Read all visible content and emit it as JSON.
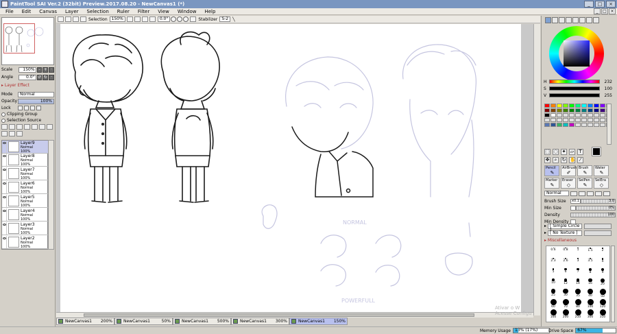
{
  "window": {
    "title": "PaintTool SAI Ver.2 (32bit) Preview.2017.08.20 - NewCanvas1 (*)",
    "controls": [
      "_",
      "□",
      "×"
    ]
  },
  "menu": [
    "File",
    "Edit",
    "Canvas",
    "Layer",
    "Selection",
    "Ruler",
    "Filter",
    "View",
    "Window",
    "Help"
  ],
  "navigator": {
    "scale_label": "Scale",
    "scale_value": "150%",
    "angle_label": "Angle",
    "angle_value": "0.0°"
  },
  "layer_panel": {
    "effect_header": "Layer Effect",
    "mode_label": "Mode",
    "mode_value": "Normal",
    "opacity_label": "Opacity",
    "opacity_value": "100%",
    "lock_label": "Lock",
    "clipping_label": "Clipping Group",
    "selection_label": "Selection Source",
    "layers": [
      {
        "name": "Layer9",
        "mode": "Normal",
        "opacity": "100%"
      },
      {
        "name": "Layer8",
        "mode": "Normal",
        "opacity": "100%"
      },
      {
        "name": "Layer7",
        "mode": "Normal",
        "opacity": "100%"
      },
      {
        "name": "Layer6",
        "mode": "Normal",
        "opacity": "100%"
      },
      {
        "name": "Layer5",
        "mode": "Normal",
        "opacity": "100%"
      },
      {
        "name": "Layer4",
        "mode": "Normal",
        "opacity": "100%"
      },
      {
        "name": "Layer3",
        "mode": "Normal",
        "opacity": "100%"
      },
      {
        "name": "Layer2",
        "mode": "Normal",
        "opacity": "100%"
      }
    ]
  },
  "canvas_toolbar": {
    "selection_label": "Selection",
    "zoom": "150%",
    "angle": "0.0°",
    "stabilizer_label": "Stabilizer",
    "stabilizer_value": "S-2"
  },
  "canvas_tabs": [
    {
      "name": "NewCanvas1",
      "zoom": "200%",
      "active": false
    },
    {
      "name": "NewCanvas1",
      "zoom": "50%",
      "active": false
    },
    {
      "name": "NewCanvas1",
      "zoom": "500%",
      "active": false
    },
    {
      "name": "NewCanvas1",
      "zoom": "300%",
      "active": false
    },
    {
      "name": "NewCanvas1",
      "zoom": "150%",
      "active": true
    }
  ],
  "watermark": {
    "line1": "Ativar o W",
    "line2": "Acesse Configu"
  },
  "sketch_labels": {
    "top": "NORMAL",
    "bottom": "POWERFULL"
  },
  "status": {
    "memory_label": "Memory Usage",
    "memory_value": "13% (17%)",
    "memory_fraction": 0.13,
    "drive_label": "Drive Space",
    "drive_value": "67%",
    "drive_fraction": 0.67
  },
  "color": {
    "h_label": "H",
    "h_value": "232",
    "s_label": "S",
    "s_value": "100",
    "v_label": "V",
    "v_value": "255",
    "selected": "#0000ff"
  },
  "palette": [
    "#ff0000",
    "#ff8000",
    "#ffff00",
    "#80ff00",
    "#00ff00",
    "#00ff80",
    "#00ffff",
    "#0080ff",
    "#0000ff",
    "#8000ff",
    "#ff00ff",
    "#800000",
    "#804000",
    "#808000",
    "#408000",
    "#008000",
    "#008040",
    "#008080",
    "#004080",
    "#000080",
    "#400080",
    "#800080",
    "#000000",
    "#ffffff",
    "#e0e0e0",
    "#e0e0e0",
    "#e0e0e0",
    "#e0e0e0",
    "#e0e0e0",
    "#e0e0e0",
    "#e0e0e0",
    "#e0e0e0",
    "#e0e0e0",
    "#e0e0e0",
    "#e0e0e0",
    "#e0e0e0",
    "#e0e0e0",
    "#e0e0e0",
    "#e0e0e0",
    "#e0e0e0",
    "#e0e0e0",
    "#e0e0e0",
    "#e0e0e0",
    "#e0e0e0",
    "#5a78b4",
    "#2f5496",
    "#3cb464",
    "#00c0c0",
    "#c000c0",
    "#e0e0e0",
    "#e0e0e0",
    "#e0e0e0",
    "#e0e0e0",
    "#e0e0e0",
    "#e0e0e0"
  ],
  "tools": {
    "text_tool": "T",
    "brushes": [
      {
        "name": "Pencil",
        "icon": "pencil-icon",
        "selected": true
      },
      {
        "name": "AirBrush",
        "icon": "airbrush-icon",
        "selected": false
      },
      {
        "name": "Brush",
        "icon": "brush-icon",
        "selected": false
      },
      {
        "name": "Water",
        "icon": "water-icon",
        "selected": false
      },
      {
        "name": "Marker",
        "icon": "marker-icon",
        "selected": false
      },
      {
        "name": "Eraser",
        "icon": "eraser-icon",
        "selected": false
      },
      {
        "name": "SelPen",
        "icon": "selpen-icon",
        "selected": false
      },
      {
        "name": "SelEra",
        "icon": "selera-icon",
        "selected": false
      }
    ]
  },
  "brush_settings": {
    "mode_value": "Normal",
    "size_label": "Brush Size",
    "size_multiplier": "x0.1",
    "size_value": "3.0",
    "min_size_label": "Min Size",
    "min_size_value": "0%",
    "density_label": "Density",
    "density_value": "100",
    "min_density_label": "Min Density",
    "shape_value": "[ Simple Circle ]",
    "texture_value": "[ No Texture ]",
    "misc_header": "Miscellaneous"
  },
  "brush_sizes": [
    "0.6",
    "0.8",
    "1",
    "1.5",
    "2",
    "2.3",
    "2.6",
    "3",
    "3.5",
    "4",
    "5",
    "6",
    "7",
    "8",
    "9",
    "10",
    "12",
    "14",
    "16",
    "20",
    "25",
    "30",
    "35",
    "40",
    "50",
    "60",
    "70",
    "80",
    "100",
    "120",
    "160",
    "200",
    "250",
    "300",
    "350"
  ]
}
